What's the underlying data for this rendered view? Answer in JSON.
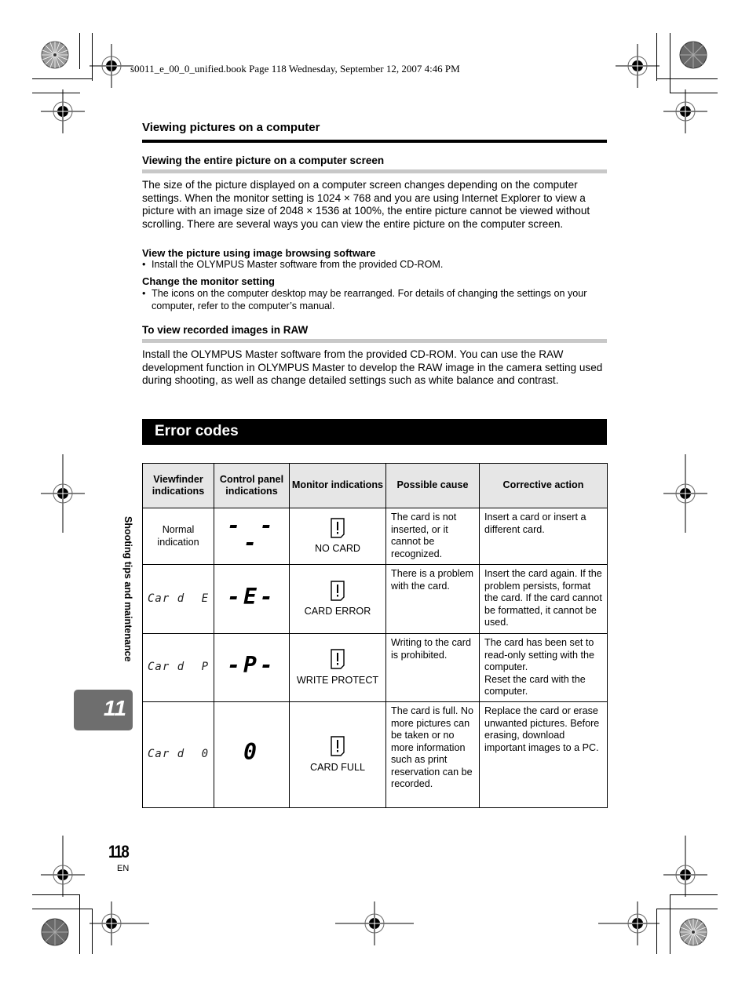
{
  "book_header": "s0011_e_00_0_unified.book  Page 118  Wednesday, September 12, 2007  4:46 PM",
  "section": {
    "title": "Viewing pictures on a computer",
    "sub1": {
      "title": "Viewing the entire picture on a computer screen",
      "body": "The size of the picture displayed on a computer screen changes depending on the computer settings. When the monitor setting is 1024 × 768 and you are using Internet Explorer to view a picture with an image size of 2048 × 1536 at 100%, the entire picture cannot be viewed without scrolling. There are several ways you can view the entire picture on the computer screen.",
      "option1_title": "View the picture using image browsing software",
      "option1_bullet": "Install the OLYMPUS Master software from the provided CD-ROM.",
      "option2_title": "Change the monitor setting",
      "option2_bullet": "The icons on the computer desktop may be rearranged. For details of changing the settings on your computer, refer to the computer’s manual."
    },
    "sub2": {
      "title": "To view recorded images in RAW",
      "body": "Install the OLYMPUS Master software from the provided CD-ROM. You can use the RAW development function in OLYMPUS Master to develop the RAW image in the camera setting used during shooting, as well as change detailed settings such as white balance and contrast."
    }
  },
  "bullet_char": "•",
  "error_codes": {
    "title": "Error codes",
    "headers": [
      "Viewfinder indications",
      "Control panel indications",
      "Monitor indications",
      "Possible cause",
      "Corrective action"
    ],
    "rows": [
      {
        "viewfinder": "Normal indication",
        "viewfinder_lcd_left": "",
        "viewfinder_lcd_right": "",
        "control_panel": "- - -",
        "monitor_icon": "card-warning-icon",
        "monitor": "NO CARD",
        "cause": "The card is not inserted, or it cannot be recognized.",
        "action": "Insert a card or insert a different card."
      },
      {
        "viewfinder": "",
        "viewfinder_lcd_left": "Car d",
        "viewfinder_lcd_right": "E",
        "control_panel": "-E-",
        "monitor_icon": "card-warning-icon",
        "monitor": "CARD ERROR",
        "cause": "There is a problem with the card.",
        "action": "Insert the card again. If the problem persists, format the card. If the card cannot be formatted, it cannot be used."
      },
      {
        "viewfinder": "",
        "viewfinder_lcd_left": "Car d",
        "viewfinder_lcd_right": "P",
        "control_panel": "-P-",
        "monitor_icon": "card-warning-icon",
        "monitor": "WRITE PROTECT",
        "cause": "Writing to the card is prohibited.",
        "action": "The card has been set to read-only setting with the computer.\nReset the card with the computer."
      },
      {
        "viewfinder": "",
        "viewfinder_lcd_left": "Car d",
        "viewfinder_lcd_right": "0",
        "control_panel": "0",
        "monitor_icon": "card-warning-icon",
        "monitor": "CARD FULL",
        "cause": "The card is full. No more pictures can be taken or no more information such as print reservation can be recorded.",
        "action": "Replace the card or erase unwanted pictures. Before erasing, download important images to a PC."
      }
    ]
  },
  "side_tab": {
    "chapter_title": "Shooting tips and maintenance",
    "chapter_number": "11",
    "tab_color": "#6e6e6e"
  },
  "footer": {
    "page_number": "118",
    "language": "EN"
  }
}
